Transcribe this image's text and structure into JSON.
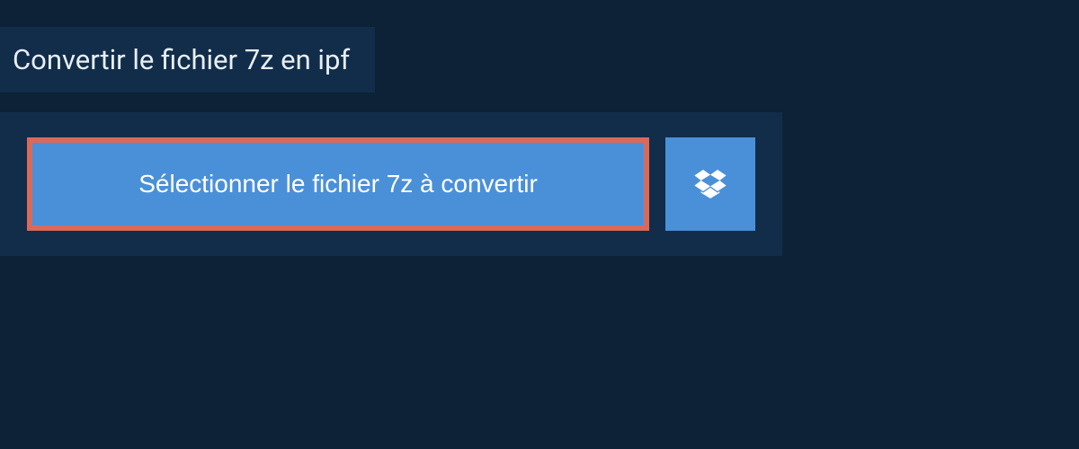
{
  "header": {
    "title": "Convertir le fichier 7z en ipf"
  },
  "actions": {
    "select_file_label": "Sélectionner le fichier 7z à convertir"
  },
  "colors": {
    "background": "#0d2237",
    "panel": "#112d49",
    "button": "#4a90d9",
    "highlight_border": "#d96a5a"
  }
}
